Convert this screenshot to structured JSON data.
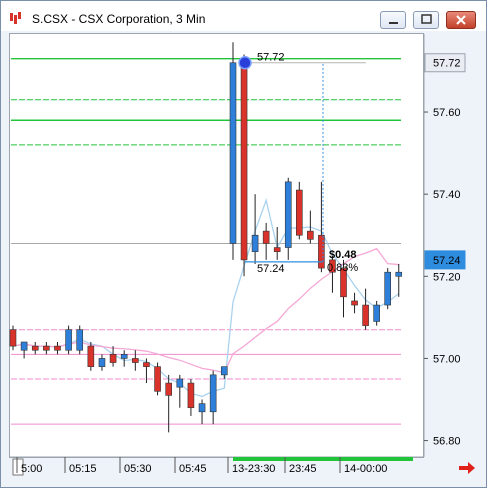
{
  "window": {
    "title": "S.CSX - CSX Corporation, 3 Min",
    "buttons": [
      "minimize",
      "maximize",
      "close"
    ]
  },
  "price_axis": {
    "ticks": [
      "57.60",
      "57.40",
      "57.20",
      "57.00",
      "56.80"
    ],
    "current_tags": [
      {
        "label": "57.72",
        "value": 57.72,
        "bg": "#e9edf3",
        "fg": "#000000"
      },
      {
        "label": "57.24",
        "value": 57.24,
        "bg": "#2f8de0",
        "fg": "#ffffff"
      }
    ]
  },
  "time_axis": {
    "labels": [
      "5:00",
      "05:15",
      "05:30",
      "05:45",
      "13-23:30",
      "23:45",
      "14-00:00"
    ]
  },
  "annotations": {
    "high_label": "57.72",
    "low_label": "57.24",
    "change_label": "$0.48",
    "pct_label": "0.83%"
  },
  "colors": {
    "up": "#2e7fd9",
    "down": "#d9322b",
    "green_line": "#22c43a",
    "pink_line": "#f08bd0",
    "ma_blue": "#a9d2ef",
    "ma_pink": "#f5a8d6",
    "ma_green": "#b6e0a8"
  },
  "chart_data": {
    "type": "candlestick",
    "ylim": [
      56.76,
      57.79
    ],
    "candles": [
      {
        "o": 57.07,
        "h": 57.08,
        "l": 57.02,
        "c": 57.03,
        "dir": "down"
      },
      {
        "o": 57.02,
        "h": 57.04,
        "l": 57.0,
        "c": 57.04,
        "dir": "up"
      },
      {
        "o": 57.03,
        "h": 57.04,
        "l": 57.01,
        "c": 57.02,
        "dir": "down"
      },
      {
        "o": 57.02,
        "h": 57.04,
        "l": 57.01,
        "c": 57.03,
        "dir": "down"
      },
      {
        "o": 57.03,
        "h": 57.04,
        "l": 57.01,
        "c": 57.02,
        "dir": "down"
      },
      {
        "o": 57.02,
        "h": 57.08,
        "l": 57.01,
        "c": 57.07,
        "dir": "up"
      },
      {
        "o": 57.02,
        "h": 57.08,
        "l": 57.01,
        "c": 57.07,
        "dir": "up"
      },
      {
        "o": 57.03,
        "h": 57.04,
        "l": 56.97,
        "c": 56.98,
        "dir": "down"
      },
      {
        "o": 56.98,
        "h": 57.01,
        "l": 56.97,
        "c": 57.0,
        "dir": "up"
      },
      {
        "o": 57.01,
        "h": 57.03,
        "l": 56.98,
        "c": 56.99,
        "dir": "down"
      },
      {
        "o": 57.0,
        "h": 57.02,
        "l": 56.98,
        "c": 57.01,
        "dir": "up"
      },
      {
        "o": 57.0,
        "h": 57.02,
        "l": 56.97,
        "c": 56.99,
        "dir": "down"
      },
      {
        "o": 56.99,
        "h": 57.0,
        "l": 56.94,
        "c": 56.98,
        "dir": "down"
      },
      {
        "o": 56.98,
        "h": 56.99,
        "l": 56.91,
        "c": 56.92,
        "dir": "down"
      },
      {
        "o": 56.94,
        "h": 56.96,
        "l": 56.82,
        "c": 56.91,
        "dir": "down"
      },
      {
        "o": 56.93,
        "h": 56.96,
        "l": 56.88,
        "c": 56.95,
        "dir": "up"
      },
      {
        "o": 56.94,
        "h": 56.95,
        "l": 56.86,
        "c": 56.88,
        "dir": "down"
      },
      {
        "o": 56.87,
        "h": 56.9,
        "l": 56.84,
        "c": 56.89,
        "dir": "up"
      },
      {
        "o": 56.87,
        "h": 56.97,
        "l": 56.84,
        "c": 56.96,
        "dir": "up"
      },
      {
        "o": 56.96,
        "h": 56.98,
        "l": 56.95,
        "c": 56.98,
        "dir": "up"
      },
      {
        "o": 57.28,
        "h": 57.77,
        "l": 57.24,
        "c": 57.72,
        "dir": "up"
      },
      {
        "o": 57.72,
        "h": 57.74,
        "l": 57.2,
        "c": 57.24,
        "dir": "down"
      },
      {
        "o": 57.26,
        "h": 57.4,
        "l": 57.23,
        "c": 57.3,
        "dir": "up"
      },
      {
        "o": 57.31,
        "h": 57.33,
        "l": 57.24,
        "c": 57.28,
        "dir": "down"
      },
      {
        "o": 57.27,
        "h": 57.32,
        "l": 57.24,
        "c": 57.26,
        "dir": "down"
      },
      {
        "o": 57.27,
        "h": 57.44,
        "l": 57.24,
        "c": 57.43,
        "dir": "up"
      },
      {
        "o": 57.41,
        "h": 57.43,
        "l": 57.29,
        "c": 57.3,
        "dir": "down"
      },
      {
        "o": 57.31,
        "h": 57.36,
        "l": 57.28,
        "c": 57.29,
        "dir": "down"
      },
      {
        "o": 57.3,
        "h": 57.43,
        "l": 57.21,
        "c": 57.22,
        "dir": "down"
      },
      {
        "o": 57.24,
        "h": 57.25,
        "l": 57.16,
        "c": 57.21,
        "dir": "down"
      },
      {
        "o": 57.22,
        "h": 57.24,
        "l": 57.1,
        "c": 57.15,
        "dir": "down"
      },
      {
        "o": 57.14,
        "h": 57.16,
        "l": 57.11,
        "c": 57.13,
        "dir": "down"
      },
      {
        "o": 57.13,
        "h": 57.17,
        "l": 57.07,
        "c": 57.08,
        "dir": "down"
      },
      {
        "o": 57.09,
        "h": 57.14,
        "l": 57.08,
        "c": 57.13,
        "dir": "up"
      },
      {
        "o": 57.13,
        "h": 57.22,
        "l": 57.12,
        "c": 57.21,
        "dir": "up"
      },
      {
        "o": 57.2,
        "h": 57.23,
        "l": 57.15,
        "c": 57.21,
        "dir": "up"
      }
    ],
    "horizontal_lines": [
      {
        "value": 57.73,
        "color": "green",
        "style": "solid"
      },
      {
        "value": 57.63,
        "color": "green",
        "style": "dashed"
      },
      {
        "value": 57.58,
        "color": "green",
        "style": "solid"
      },
      {
        "value": 57.52,
        "color": "green",
        "style": "dashed"
      },
      {
        "value": 57.28,
        "color": "gray",
        "style": "solid"
      },
      {
        "value": 57.07,
        "color": "pink",
        "style": "dashed"
      },
      {
        "value": 57.01,
        "color": "pink",
        "style": "solid"
      },
      {
        "value": 56.95,
        "color": "pink",
        "style": "dashed"
      },
      {
        "value": 56.84,
        "color": "pink",
        "style": "solid"
      }
    ]
  }
}
